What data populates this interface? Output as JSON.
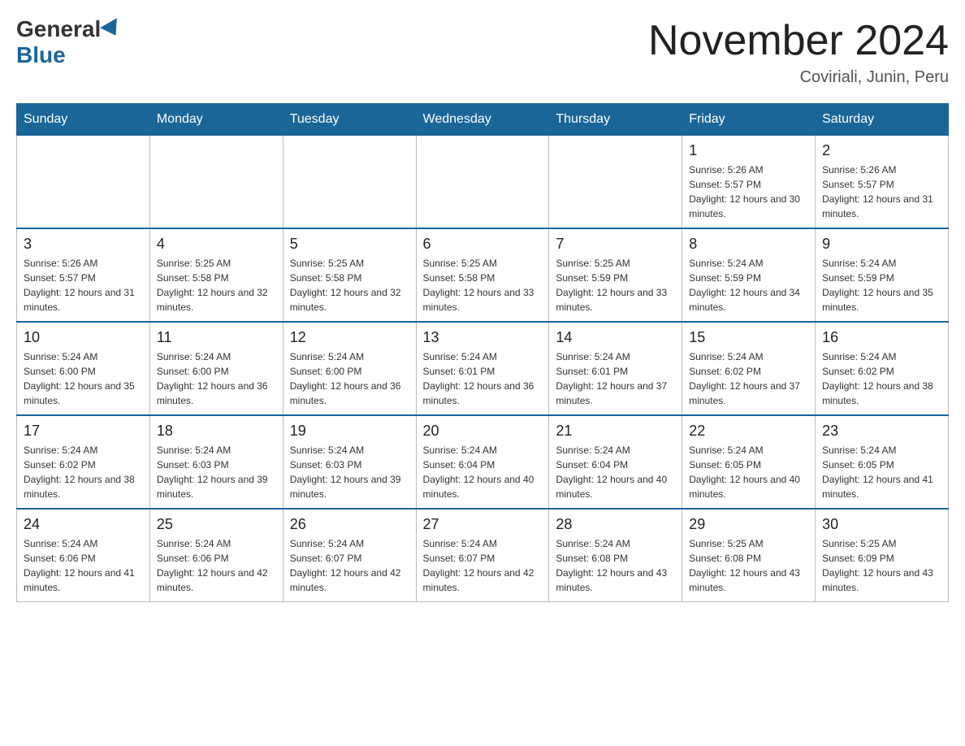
{
  "header": {
    "logo_general": "General",
    "logo_blue": "Blue",
    "title": "November 2024",
    "location": "Coviriali, Junin, Peru"
  },
  "days_of_week": [
    "Sunday",
    "Monday",
    "Tuesday",
    "Wednesday",
    "Thursday",
    "Friday",
    "Saturday"
  ],
  "weeks": [
    [
      {
        "day": "",
        "info": ""
      },
      {
        "day": "",
        "info": ""
      },
      {
        "day": "",
        "info": ""
      },
      {
        "day": "",
        "info": ""
      },
      {
        "day": "",
        "info": ""
      },
      {
        "day": "1",
        "info": "Sunrise: 5:26 AM\nSunset: 5:57 PM\nDaylight: 12 hours and 30 minutes."
      },
      {
        "day": "2",
        "info": "Sunrise: 5:26 AM\nSunset: 5:57 PM\nDaylight: 12 hours and 31 minutes."
      }
    ],
    [
      {
        "day": "3",
        "info": "Sunrise: 5:26 AM\nSunset: 5:57 PM\nDaylight: 12 hours and 31 minutes."
      },
      {
        "day": "4",
        "info": "Sunrise: 5:25 AM\nSunset: 5:58 PM\nDaylight: 12 hours and 32 minutes."
      },
      {
        "day": "5",
        "info": "Sunrise: 5:25 AM\nSunset: 5:58 PM\nDaylight: 12 hours and 32 minutes."
      },
      {
        "day": "6",
        "info": "Sunrise: 5:25 AM\nSunset: 5:58 PM\nDaylight: 12 hours and 33 minutes."
      },
      {
        "day": "7",
        "info": "Sunrise: 5:25 AM\nSunset: 5:59 PM\nDaylight: 12 hours and 33 minutes."
      },
      {
        "day": "8",
        "info": "Sunrise: 5:24 AM\nSunset: 5:59 PM\nDaylight: 12 hours and 34 minutes."
      },
      {
        "day": "9",
        "info": "Sunrise: 5:24 AM\nSunset: 5:59 PM\nDaylight: 12 hours and 35 minutes."
      }
    ],
    [
      {
        "day": "10",
        "info": "Sunrise: 5:24 AM\nSunset: 6:00 PM\nDaylight: 12 hours and 35 minutes."
      },
      {
        "day": "11",
        "info": "Sunrise: 5:24 AM\nSunset: 6:00 PM\nDaylight: 12 hours and 36 minutes."
      },
      {
        "day": "12",
        "info": "Sunrise: 5:24 AM\nSunset: 6:00 PM\nDaylight: 12 hours and 36 minutes."
      },
      {
        "day": "13",
        "info": "Sunrise: 5:24 AM\nSunset: 6:01 PM\nDaylight: 12 hours and 36 minutes."
      },
      {
        "day": "14",
        "info": "Sunrise: 5:24 AM\nSunset: 6:01 PM\nDaylight: 12 hours and 37 minutes."
      },
      {
        "day": "15",
        "info": "Sunrise: 5:24 AM\nSunset: 6:02 PM\nDaylight: 12 hours and 37 minutes."
      },
      {
        "day": "16",
        "info": "Sunrise: 5:24 AM\nSunset: 6:02 PM\nDaylight: 12 hours and 38 minutes."
      }
    ],
    [
      {
        "day": "17",
        "info": "Sunrise: 5:24 AM\nSunset: 6:02 PM\nDaylight: 12 hours and 38 minutes."
      },
      {
        "day": "18",
        "info": "Sunrise: 5:24 AM\nSunset: 6:03 PM\nDaylight: 12 hours and 39 minutes."
      },
      {
        "day": "19",
        "info": "Sunrise: 5:24 AM\nSunset: 6:03 PM\nDaylight: 12 hours and 39 minutes."
      },
      {
        "day": "20",
        "info": "Sunrise: 5:24 AM\nSunset: 6:04 PM\nDaylight: 12 hours and 40 minutes."
      },
      {
        "day": "21",
        "info": "Sunrise: 5:24 AM\nSunset: 6:04 PM\nDaylight: 12 hours and 40 minutes."
      },
      {
        "day": "22",
        "info": "Sunrise: 5:24 AM\nSunset: 6:05 PM\nDaylight: 12 hours and 40 minutes."
      },
      {
        "day": "23",
        "info": "Sunrise: 5:24 AM\nSunset: 6:05 PM\nDaylight: 12 hours and 41 minutes."
      }
    ],
    [
      {
        "day": "24",
        "info": "Sunrise: 5:24 AM\nSunset: 6:06 PM\nDaylight: 12 hours and 41 minutes."
      },
      {
        "day": "25",
        "info": "Sunrise: 5:24 AM\nSunset: 6:06 PM\nDaylight: 12 hours and 42 minutes."
      },
      {
        "day": "26",
        "info": "Sunrise: 5:24 AM\nSunset: 6:07 PM\nDaylight: 12 hours and 42 minutes."
      },
      {
        "day": "27",
        "info": "Sunrise: 5:24 AM\nSunset: 6:07 PM\nDaylight: 12 hours and 42 minutes."
      },
      {
        "day": "28",
        "info": "Sunrise: 5:24 AM\nSunset: 6:08 PM\nDaylight: 12 hours and 43 minutes."
      },
      {
        "day": "29",
        "info": "Sunrise: 5:25 AM\nSunset: 6:08 PM\nDaylight: 12 hours and 43 minutes."
      },
      {
        "day": "30",
        "info": "Sunrise: 5:25 AM\nSunset: 6:09 PM\nDaylight: 12 hours and 43 minutes."
      }
    ]
  ]
}
